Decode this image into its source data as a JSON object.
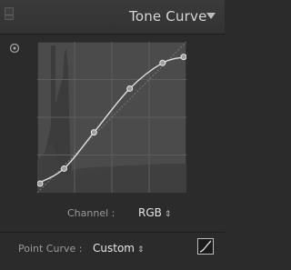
{
  "header": {
    "title": "Tone Curve"
  },
  "icons": {
    "collapse": "collapse-handle-icon",
    "target": "targeted-adjustment-icon",
    "disclosure": "disclosure-triangle-icon",
    "edit_curve": "edit-point-curve-icon"
  },
  "channel": {
    "label": "Channel :",
    "value": "RGB",
    "stepper": "⇕"
  },
  "point_curve": {
    "label": "Point Curve :",
    "value": "Custom",
    "stepper": "⇕"
  },
  "curve": {
    "control_points": [
      {
        "input": 0,
        "output": 6
      },
      {
        "input": 18,
        "output": 16
      },
      {
        "input": 38,
        "output": 40
      },
      {
        "input": 62,
        "output": 69
      },
      {
        "input": 84,
        "output": 86
      },
      {
        "input": 100,
        "output": 90
      }
    ]
  },
  "colors": {
    "panel_bg": "#2b2b2b",
    "graph_bg": "#4b4b4b",
    "curve": "#e0e0e0",
    "point_fill": "#9d9d9d"
  }
}
